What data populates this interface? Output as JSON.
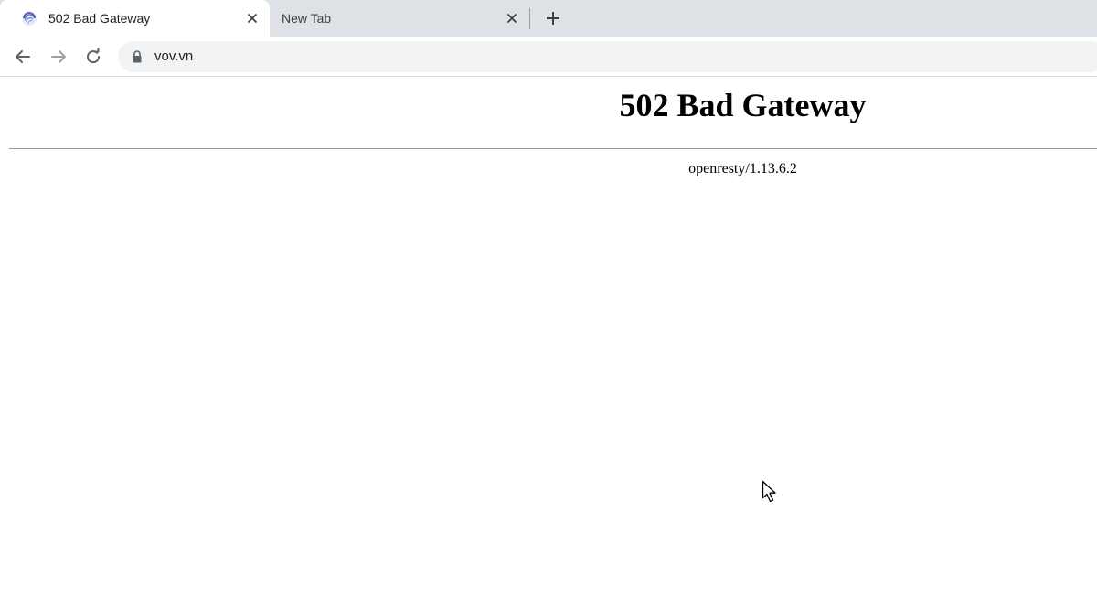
{
  "browser": {
    "tabs": [
      {
        "title": "502 Bad Gateway",
        "active": true,
        "favicon": "globe-swirl-icon"
      },
      {
        "title": "New Tab",
        "active": false
      }
    ],
    "new_tab_icon": "plus-icon",
    "close_icon": "close-icon",
    "address_bar": {
      "url": "vov.vn",
      "secure_icon": "lock-icon"
    },
    "nav": {
      "back_icon": "back-arrow-icon",
      "forward_icon": "forward-arrow-icon",
      "reload_icon": "reload-icon"
    }
  },
  "page": {
    "title": "502 Bad Gateway",
    "server": "openresty/1.13.6.2"
  },
  "colors": {
    "tabstrip": "#dee1e6",
    "omnibox": "#f1f3f4",
    "favicon": "#4a58b5"
  }
}
